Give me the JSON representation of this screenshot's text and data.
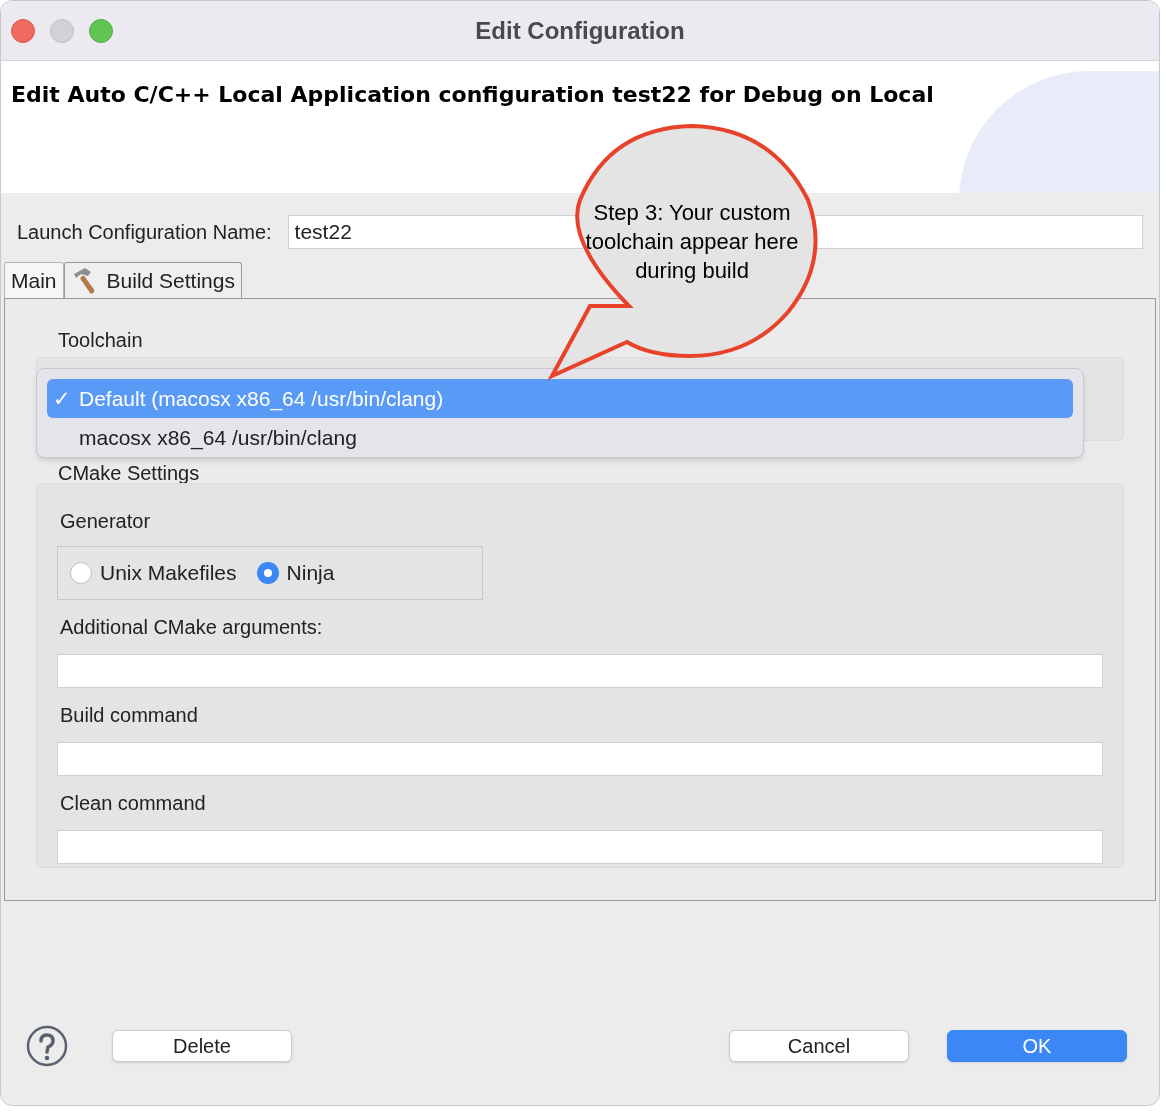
{
  "window": {
    "title": "Edit Configuration"
  },
  "header": {
    "title": "Edit Auto C/C++ Local Application configuration test22 for Debug on Local"
  },
  "name_field": {
    "label": "Launch Configuration Name:",
    "value": "test22"
  },
  "tabs": [
    {
      "label": "Main",
      "selected": false,
      "icon": false
    },
    {
      "label": "Build Settings",
      "selected": true,
      "icon": true
    }
  ],
  "toolchain": {
    "label": "Toolchain",
    "options": [
      {
        "label": "Default (macosx x86_64 /usr/bin/clang)",
        "selected": true,
        "check": "✓"
      },
      {
        "label": "macosx x86_64 /usr/bin/clang",
        "selected": false
      }
    ]
  },
  "cmake": {
    "title": "CMake Settings",
    "generator_label": "Generator",
    "generators": [
      {
        "label": "Unix Makefiles",
        "selected": false
      },
      {
        "label": "Ninja",
        "selected": true
      }
    ],
    "fields": [
      {
        "label": "Additional CMake arguments:"
      },
      {
        "label": "Build command"
      },
      {
        "label": "Clean command"
      }
    ]
  },
  "callout": {
    "text": "Step 3: Your custom toolchain appear here during build"
  },
  "buttons": [
    {
      "label": "Delete",
      "kind": "plain"
    },
    {
      "label": "Cancel",
      "kind": "plain"
    },
    {
      "label": "OK",
      "kind": "default"
    }
  ]
}
